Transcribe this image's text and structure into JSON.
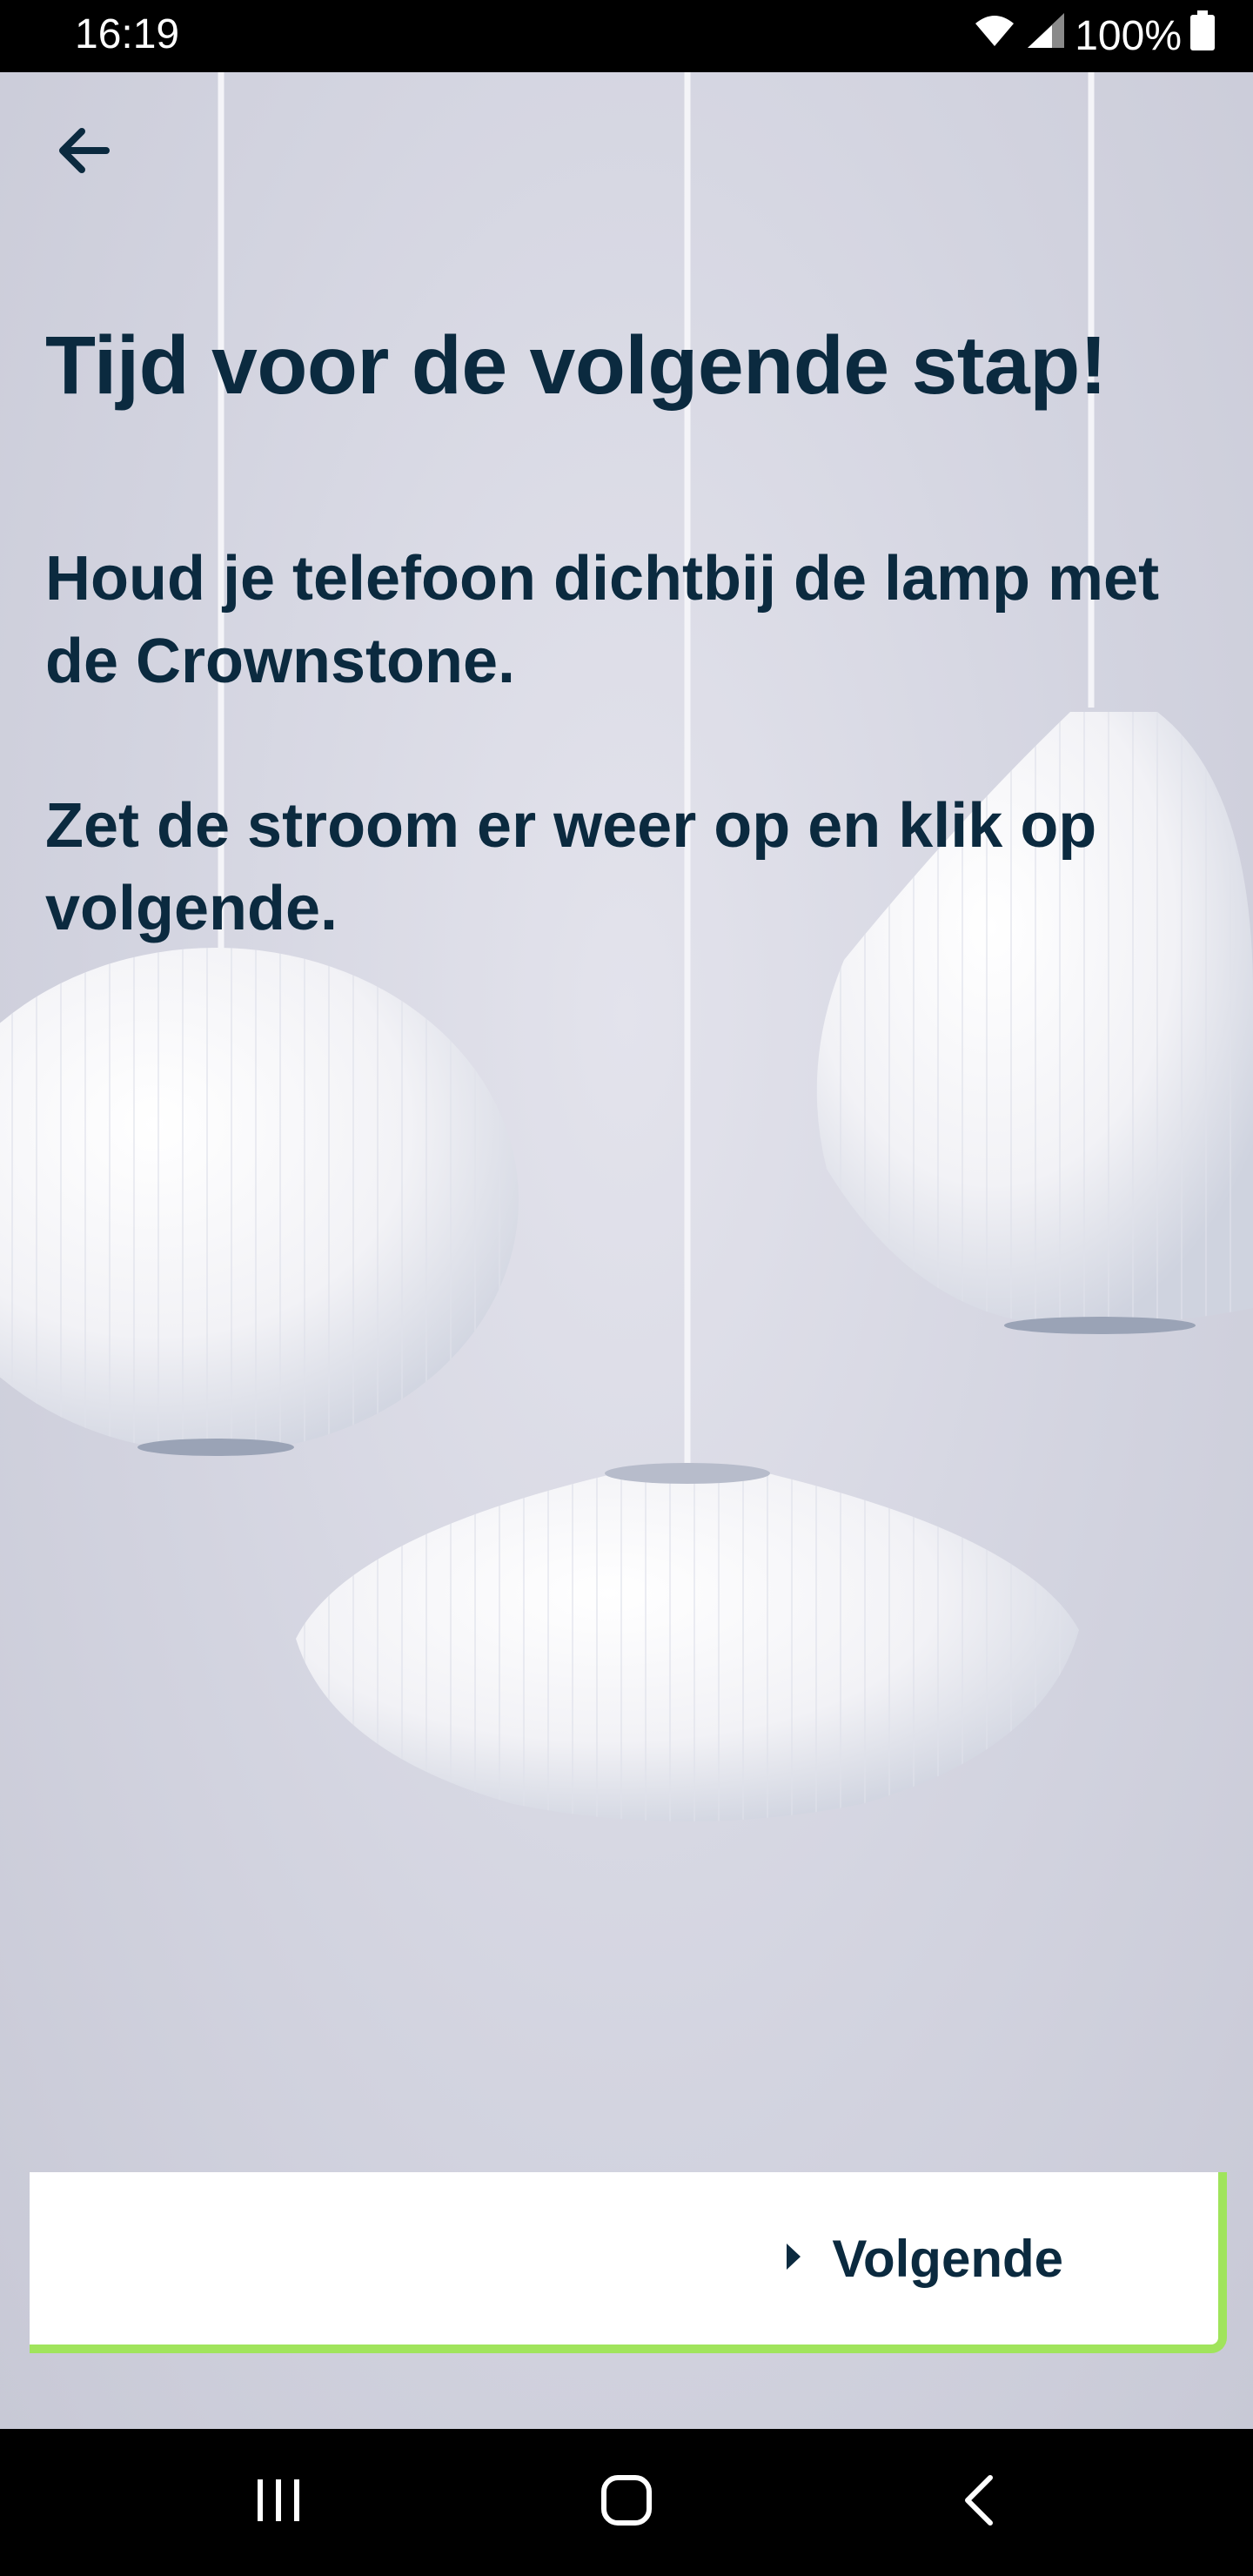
{
  "status_bar": {
    "time": "16:19",
    "battery": "100%",
    "icons": [
      "wifi-icon",
      "signal-icon",
      "battery-icon"
    ]
  },
  "header": {
    "back_icon": "arrow-left-icon"
  },
  "content": {
    "title": "Tijd voor de volgende stap!",
    "paragraphs": [
      "Houd je telefoon dichtbij de lamp met de Crownstone.",
      "Zet de stroom er weer op en klik op volgende."
    ]
  },
  "next_button": {
    "label": "Volgende",
    "icon": "caret-right-icon"
  },
  "nav_bar": {
    "items": [
      "recent-apps-icon",
      "home-icon",
      "back-icon"
    ]
  },
  "colors": {
    "text": "#0b2a3f",
    "accent": "#a0e45c",
    "button_bg": "#ffffff"
  }
}
